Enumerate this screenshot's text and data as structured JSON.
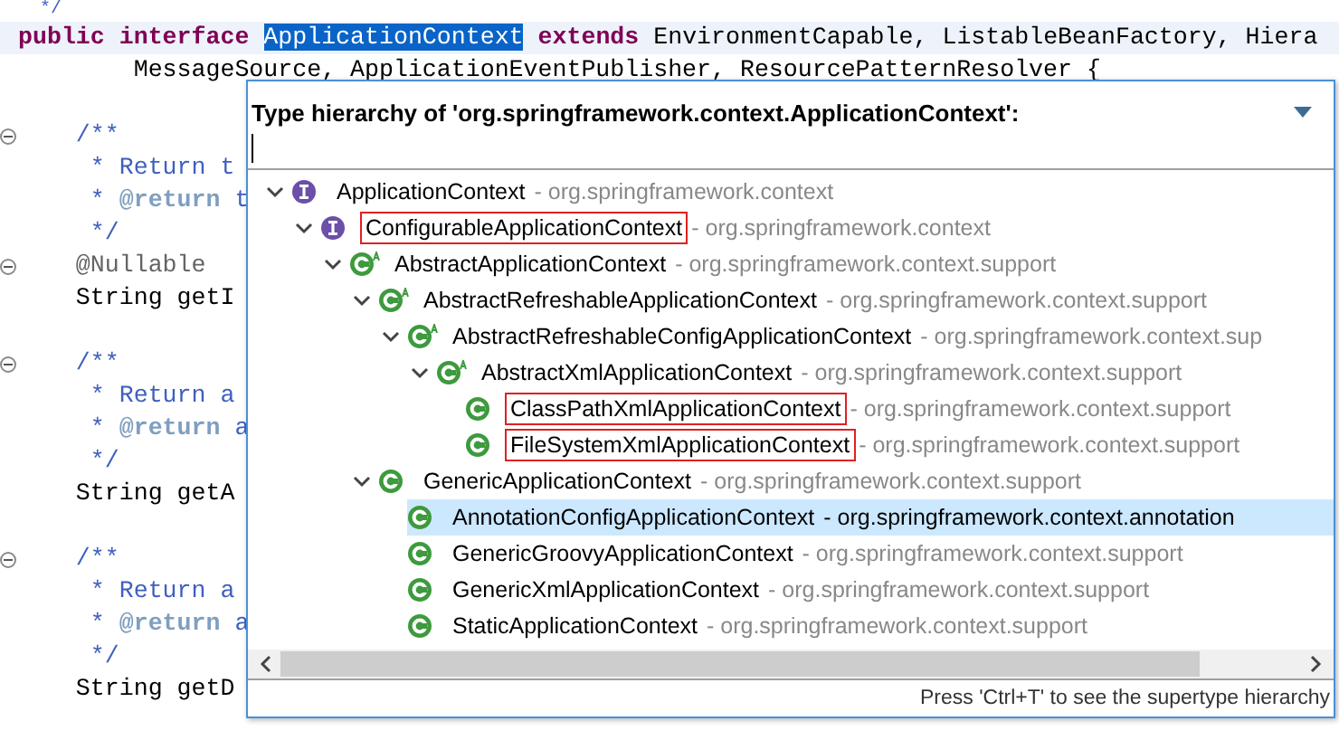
{
  "editor": {
    "lines": [
      {
        "fold": false,
        "current": false,
        "tokens": [
          {
            "kind": "comment",
            "text": "  */"
          }
        ]
      },
      {
        "fold": false,
        "current": true,
        "tokens": [
          {
            "kind": "keyword",
            "text": "public interface "
          },
          {
            "kind": "selected",
            "text": "ApplicationContext"
          },
          {
            "kind": "keyword",
            "text": " extends"
          },
          {
            "kind": "plain",
            "text": " EnvironmentCapable, ListableBeanFactory, Hiera"
          }
        ]
      },
      {
        "fold": false,
        "current": false,
        "tokens": [
          {
            "kind": "plain",
            "text": "        MessageSource, ApplicationEventPublisher, ResourcePatternResolver {"
          }
        ]
      },
      {
        "fold": false,
        "current": false
      },
      {
        "fold": true,
        "current": false,
        "tokens": [
          {
            "kind": "comment",
            "text": "    /**"
          }
        ]
      },
      {
        "fold": false,
        "current": false,
        "tokens": [
          {
            "kind": "comment",
            "text": "     * Return t"
          }
        ]
      },
      {
        "fold": false,
        "current": false,
        "tokens": [
          {
            "kind": "comment",
            "text": "     * "
          },
          {
            "kind": "doctag",
            "text": "@return"
          },
          {
            "kind": "comment",
            "text": " t"
          }
        ]
      },
      {
        "fold": false,
        "current": false,
        "tokens": [
          {
            "kind": "comment",
            "text": "     */"
          }
        ]
      },
      {
        "fold": true,
        "current": false,
        "tokens": [
          {
            "kind": "annotation",
            "text": "    @Nullable"
          }
        ]
      },
      {
        "fold": false,
        "current": false,
        "tokens": [
          {
            "kind": "plain",
            "text": "    String getI"
          }
        ]
      },
      {
        "fold": false,
        "current": false
      },
      {
        "fold": true,
        "current": false,
        "tokens": [
          {
            "kind": "comment",
            "text": "    /**"
          }
        ]
      },
      {
        "fold": false,
        "current": false,
        "tokens": [
          {
            "kind": "comment",
            "text": "     * Return a"
          }
        ]
      },
      {
        "fold": false,
        "current": false,
        "tokens": [
          {
            "kind": "comment",
            "text": "     * "
          },
          {
            "kind": "doctag",
            "text": "@return"
          },
          {
            "kind": "comment",
            "text": " a"
          }
        ]
      },
      {
        "fold": false,
        "current": false,
        "tokens": [
          {
            "kind": "comment",
            "text": "     */"
          }
        ]
      },
      {
        "fold": false,
        "current": false,
        "tokens": [
          {
            "kind": "plain",
            "text": "    String getA"
          }
        ]
      },
      {
        "fold": false,
        "current": false
      },
      {
        "fold": true,
        "current": false,
        "tokens": [
          {
            "kind": "comment",
            "text": "    /**"
          }
        ]
      },
      {
        "fold": false,
        "current": false,
        "tokens": [
          {
            "kind": "comment",
            "text": "     * Return a"
          }
        ]
      },
      {
        "fold": false,
        "current": false,
        "tokens": [
          {
            "kind": "comment",
            "text": "     * "
          },
          {
            "kind": "doctag",
            "text": "@return"
          },
          {
            "kind": "comment",
            "text": " a"
          }
        ]
      },
      {
        "fold": false,
        "current": false,
        "tokens": [
          {
            "kind": "comment",
            "text": "     */"
          }
        ]
      },
      {
        "fold": false,
        "current": false,
        "tokens": [
          {
            "kind": "plain",
            "text": "    String getD"
          }
        ]
      }
    ]
  },
  "popup": {
    "title": "Type hierarchy of 'org.springframework.context.ApplicationContext':",
    "tree": [
      {
        "name": "ApplicationContext",
        "package": "- org.springframework.context",
        "kind": "interface",
        "expanded": true,
        "highlighted": false,
        "selected": false,
        "children": [
          {
            "name": "ConfigurableApplicationContext",
            "package": "- org.springframework.context",
            "kind": "interface",
            "expanded": true,
            "highlighted": true,
            "selected": false,
            "children": [
              {
                "name": "AbstractApplicationContext",
                "package": "- org.springframework.context.support",
                "kind": "class",
                "abstract": true,
                "expanded": true,
                "highlighted": false,
                "selected": false,
                "children": [
                  {
                    "name": "AbstractRefreshableApplicationContext",
                    "package": "- org.springframework.context.support",
                    "kind": "class",
                    "abstract": true,
                    "expanded": true,
                    "highlighted": false,
                    "selected": false,
                    "children": [
                      {
                        "name": "AbstractRefreshableConfigApplicationContext",
                        "package": "- org.springframework.context.sup",
                        "kind": "class",
                        "abstract": true,
                        "expanded": true,
                        "highlighted": false,
                        "selected": false,
                        "children": [
                          {
                            "name": "AbstractXmlApplicationContext",
                            "package": "- org.springframework.context.support",
                            "kind": "class",
                            "abstract": true,
                            "expanded": true,
                            "highlighted": false,
                            "selected": false,
                            "children": [
                              {
                                "name": "ClassPathXmlApplicationContext",
                                "package": "- org.springframework.context.support",
                                "kind": "class",
                                "abstract": false,
                                "highlighted": true,
                                "selected": false
                              },
                              {
                                "name": "FileSystemXmlApplicationContext",
                                "package": "- org.springframework.context.support",
                                "kind": "class",
                                "abstract": false,
                                "highlighted": true,
                                "selected": false
                              }
                            ]
                          }
                        ]
                      }
                    ]
                  },
                  {
                    "name": "GenericApplicationContext",
                    "package": "- org.springframework.context.support",
                    "kind": "class",
                    "abstract": false,
                    "expanded": true,
                    "highlighted": false,
                    "selected": false,
                    "children": [
                      {
                        "name": "AnnotationConfigApplicationContext",
                        "package": "- org.springframework.context.annotation",
                        "kind": "class",
                        "abstract": false,
                        "highlighted": false,
                        "selected": true
                      },
                      {
                        "name": "GenericGroovyApplicationContext",
                        "package": "- org.springframework.context.support",
                        "kind": "class",
                        "abstract": false,
                        "highlighted": false,
                        "selected": false
                      },
                      {
                        "name": "GenericXmlApplicationContext",
                        "package": "- org.springframework.context.support",
                        "kind": "class",
                        "abstract": false,
                        "highlighted": false,
                        "selected": false
                      },
                      {
                        "name": "StaticApplicationContext",
                        "package": "- org.springframework.context.support",
                        "kind": "class",
                        "abstract": false,
                        "highlighted": false,
                        "selected": false
                      }
                    ]
                  }
                ]
              }
            ]
          }
        ]
      }
    ],
    "status": "Press 'Ctrl+T' to see the supertype hierarchy"
  }
}
